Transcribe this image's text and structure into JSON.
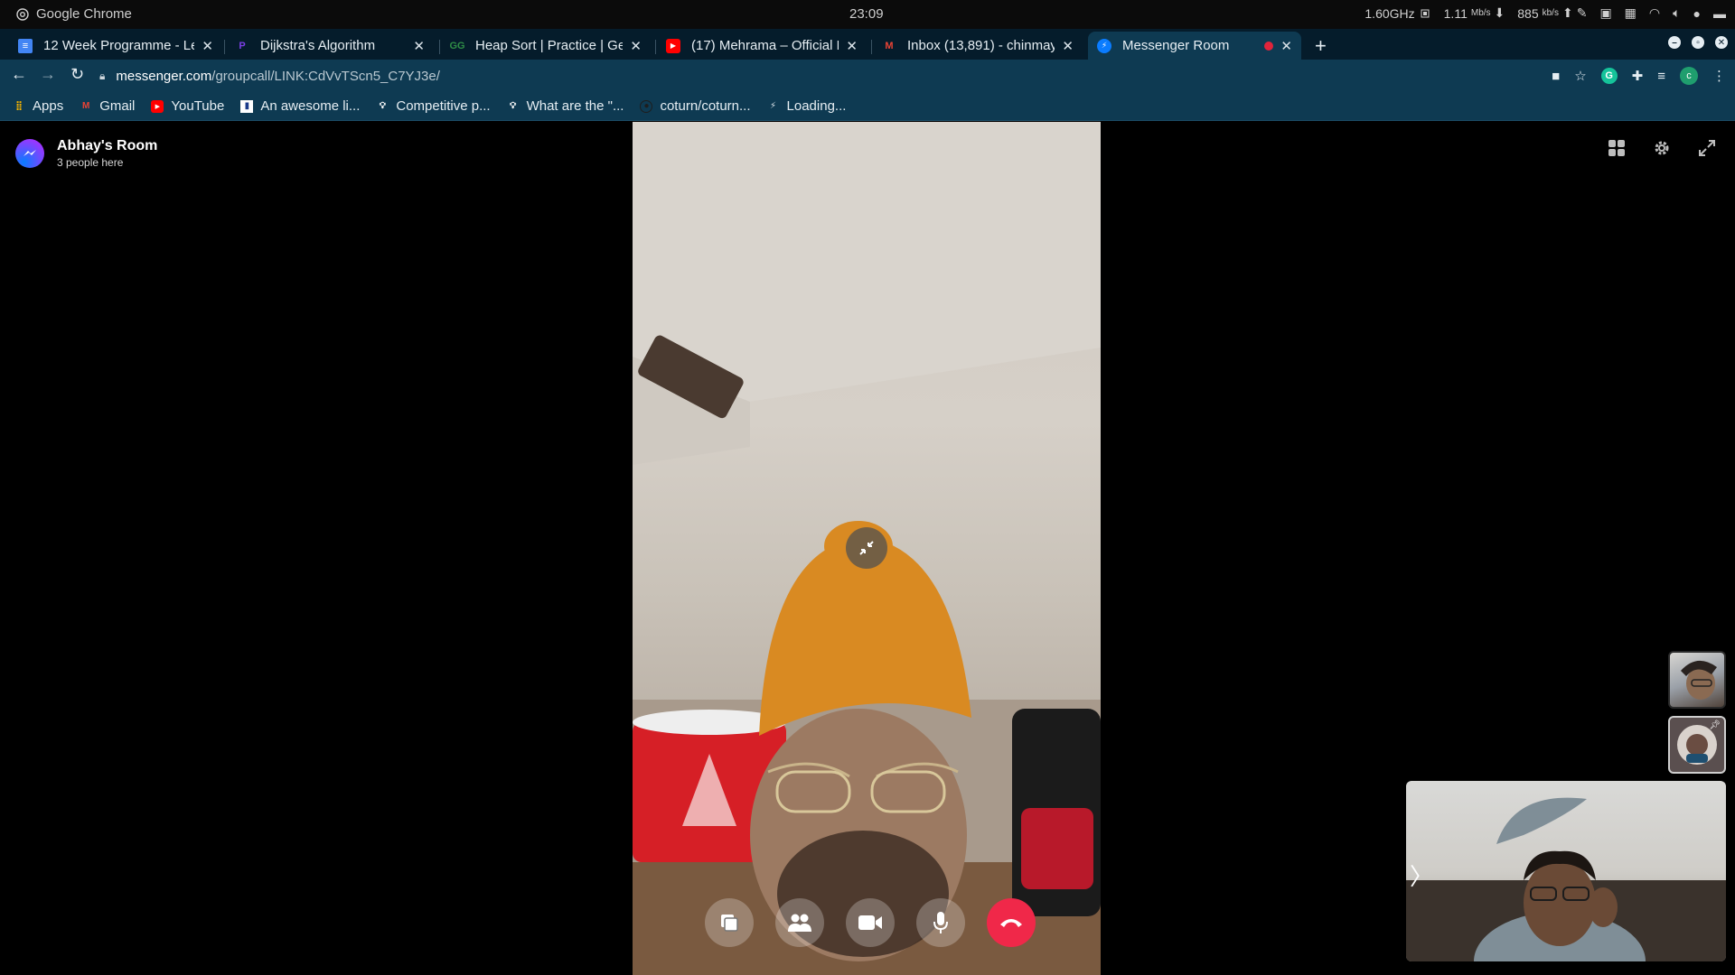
{
  "os": {
    "app_name": "Google Chrome",
    "clock": "23:09",
    "cpu": "1.60GHz",
    "net_down": "1.11",
    "net_down_unit": "Mb/s",
    "net_up": "885",
    "net_up_unit": "kb/s"
  },
  "tabs": [
    {
      "title": "12 Week Programme - Lee",
      "favicon": "docs-icon",
      "color": "#4285f4",
      "close": "✕"
    },
    {
      "title": "Dijkstra's Algorithm",
      "favicon": "pen-icon",
      "color": "#7b3fe4",
      "close": "✕"
    },
    {
      "title": "Heap Sort | Practice | Geek",
      "favicon": "gfg-icon",
      "color": "#2f8d46",
      "close": "✕"
    },
    {
      "title": "(17) Mehrama – Official Re",
      "favicon": "youtube-icon",
      "color": "#ff0000",
      "close": "✕"
    },
    {
      "title": "Inbox (13,891) - chinmay1",
      "favicon": "gmail-icon",
      "color": "#ea4335",
      "close": "✕"
    },
    {
      "title": "Messenger Room",
      "favicon": "messenger-icon",
      "color": "#0a7cff",
      "close": "✕",
      "active": true
    }
  ],
  "new_tab_label": "+",
  "address": {
    "domain": "messenger.com",
    "path": "/groupcall/LINK:CdVvTScn5_C7YJ3e/"
  },
  "bookmarks": [
    {
      "label": "Apps",
      "icon": "apps-grid-icon"
    },
    {
      "label": "Gmail",
      "icon": "gmail-icon"
    },
    {
      "label": "YouTube",
      "icon": "youtube-icon"
    },
    {
      "label": "An awesome li...",
      "icon": "bookmark-icon"
    },
    {
      "label": "Competitive p...",
      "icon": "bulb-icon"
    },
    {
      "label": "What are the \"...",
      "icon": "bulb-icon"
    },
    {
      "label": "coturn/coturn...",
      "icon": "github-icon"
    },
    {
      "label": "Loading...",
      "icon": "loading-icon"
    }
  ],
  "room": {
    "name": "Abhay's Room",
    "count": "3 people here"
  },
  "colors": {
    "end_call": "#f02849",
    "messenger": "#0a7cff"
  }
}
